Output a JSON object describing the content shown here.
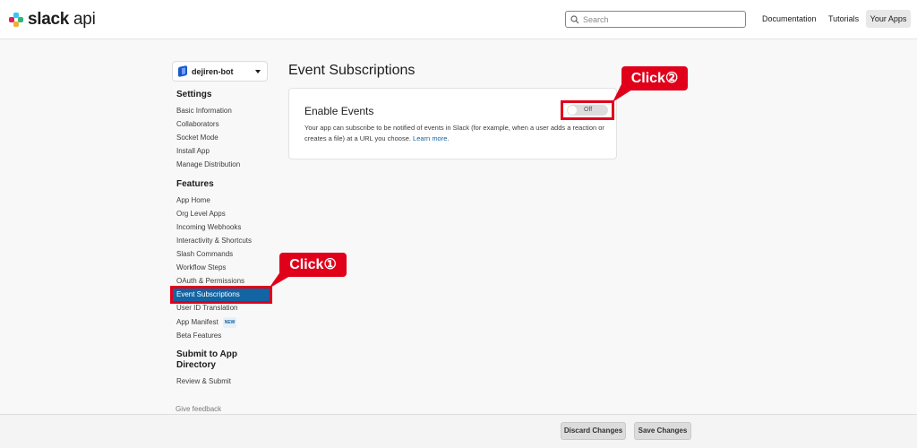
{
  "header": {
    "logo_text": "slack",
    "logo_suffix": "api",
    "search_placeholder": "Search",
    "nav": {
      "documentation": "Documentation",
      "tutorials": "Tutorials",
      "your_apps": "Your Apps"
    }
  },
  "sidebar": {
    "app_name": "dejiren-bot",
    "settings_heading": "Settings",
    "settings_items": [
      "Basic Information",
      "Collaborators",
      "Socket Mode",
      "Install App",
      "Manage Distribution"
    ],
    "features_heading": "Features",
    "features_items": [
      "App Home",
      "Org Level Apps",
      "Incoming Webhooks",
      "Interactivity & Shortcuts",
      "Slash Commands",
      "Workflow Steps",
      "OAuth & Permissions",
      "Event Subscriptions",
      "User ID Translation",
      "App Manifest",
      "Beta Features"
    ],
    "new_badge": "NEW",
    "submit_heading": "Submit to App Directory",
    "submit_items": [
      "Review & Submit"
    ],
    "feedback": "Give feedback"
  },
  "main": {
    "title": "Event Subscriptions",
    "card": {
      "title": "Enable Events",
      "description": "Your app can subscribe to be notified of events in Slack (for example, when a user adds a reaction or creates a file) at a URL you choose.",
      "learn_more": "Learn more.",
      "toggle_label": "Off"
    }
  },
  "annotations": {
    "click1": "Click①",
    "click2": "Click②",
    "color": "#e1001a"
  },
  "footer": {
    "discard": "Discard Changes",
    "save": "Save Changes"
  }
}
